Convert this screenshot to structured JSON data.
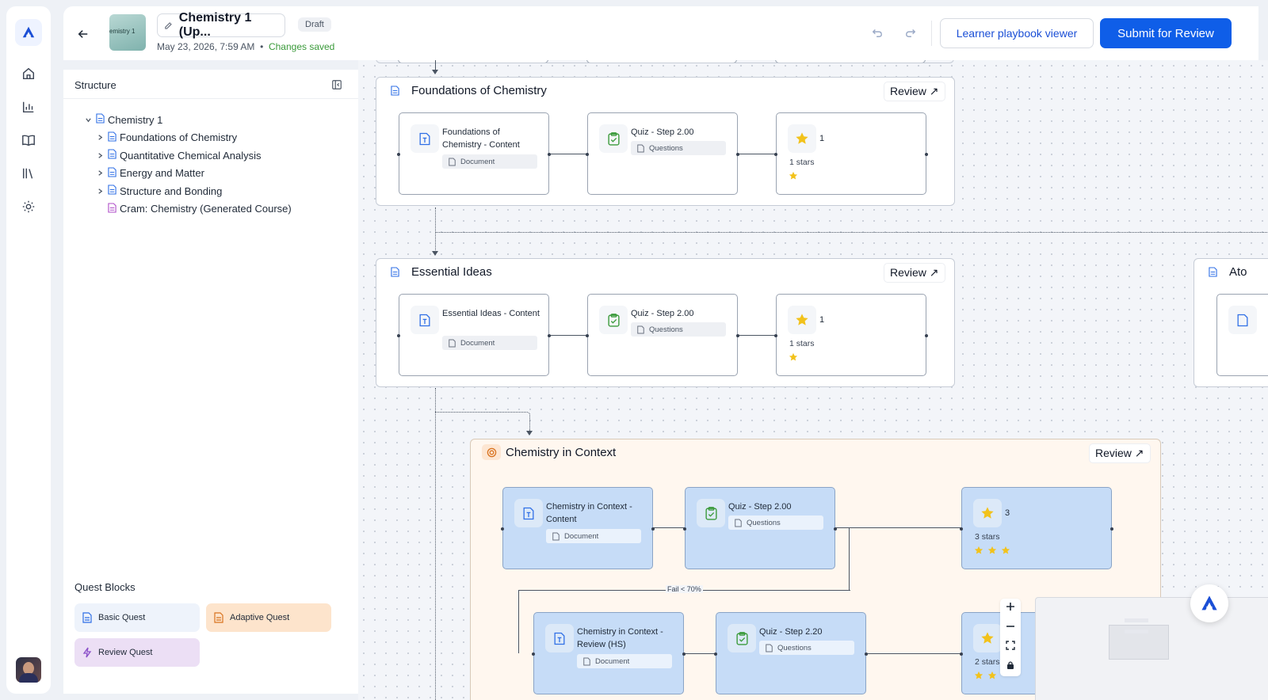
{
  "header": {
    "course_thumb_text": "emistry 1",
    "title": "Chemistry 1 (Up...",
    "status_badge": "Draft",
    "timestamp": "May 23, 2026, 7:59 AM",
    "separator": "•",
    "save_status": "Changes saved",
    "viewer_button": "Learner playbook viewer",
    "submit_button": "Submit for Review"
  },
  "structure": {
    "heading": "Structure",
    "root": "Chemistry 1",
    "items": [
      "Foundations of Chemistry",
      "Quantitative Chemical Analysis",
      "Energy and Matter",
      "Structure and Bonding",
      "Cram: Chemistry (Generated Course)"
    ]
  },
  "quest_blocks": {
    "heading": "Quest Blocks",
    "basic": "Basic Quest",
    "adaptive": "Adaptive Quest",
    "review": "Review Quest"
  },
  "canvas": {
    "review_label": "Review ↗",
    "groups": [
      {
        "title": "Foundations of Chemistry",
        "content_node": "Foundations of Chemistry - Content",
        "content_type": "Document",
        "quiz_node": "Quiz - Step 2.00",
        "quiz_type": "Questions",
        "star_count": "1",
        "stars_label": "1 stars",
        "stars": 1
      },
      {
        "title": "Essential Ideas",
        "content_node": "Essential Ideas - Content",
        "content_type": "Document",
        "quiz_node": "Quiz - Step 2.00",
        "quiz_type": "Questions",
        "star_count": "1",
        "stars_label": "1 stars",
        "stars": 1
      },
      {
        "title": "Chemistry in Context",
        "content_node": "Chemistry in Context - Content",
        "content_type": "Document",
        "quiz_node": "Quiz - Step 2.00",
        "quiz_type": "Questions",
        "star_count": "3",
        "stars_label": "3 stars",
        "stars": 3,
        "fail_label": "Fail < 70%",
        "review_node": "Chemistry in Context - Review (HS)",
        "review_type": "Document",
        "quiz2_node": "Quiz - Step 2.20",
        "quiz2_type": "Questions",
        "stars2_label": "2 stars",
        "stars2": 2
      }
    ],
    "partial_group_title": "Ato"
  },
  "colors": {
    "primary": "#0f5ee8",
    "saved": "#3a9a3a",
    "adaptive_bg": "#fff7ef",
    "node_blue": "#c6dcf7",
    "star": "#f2c21b"
  }
}
